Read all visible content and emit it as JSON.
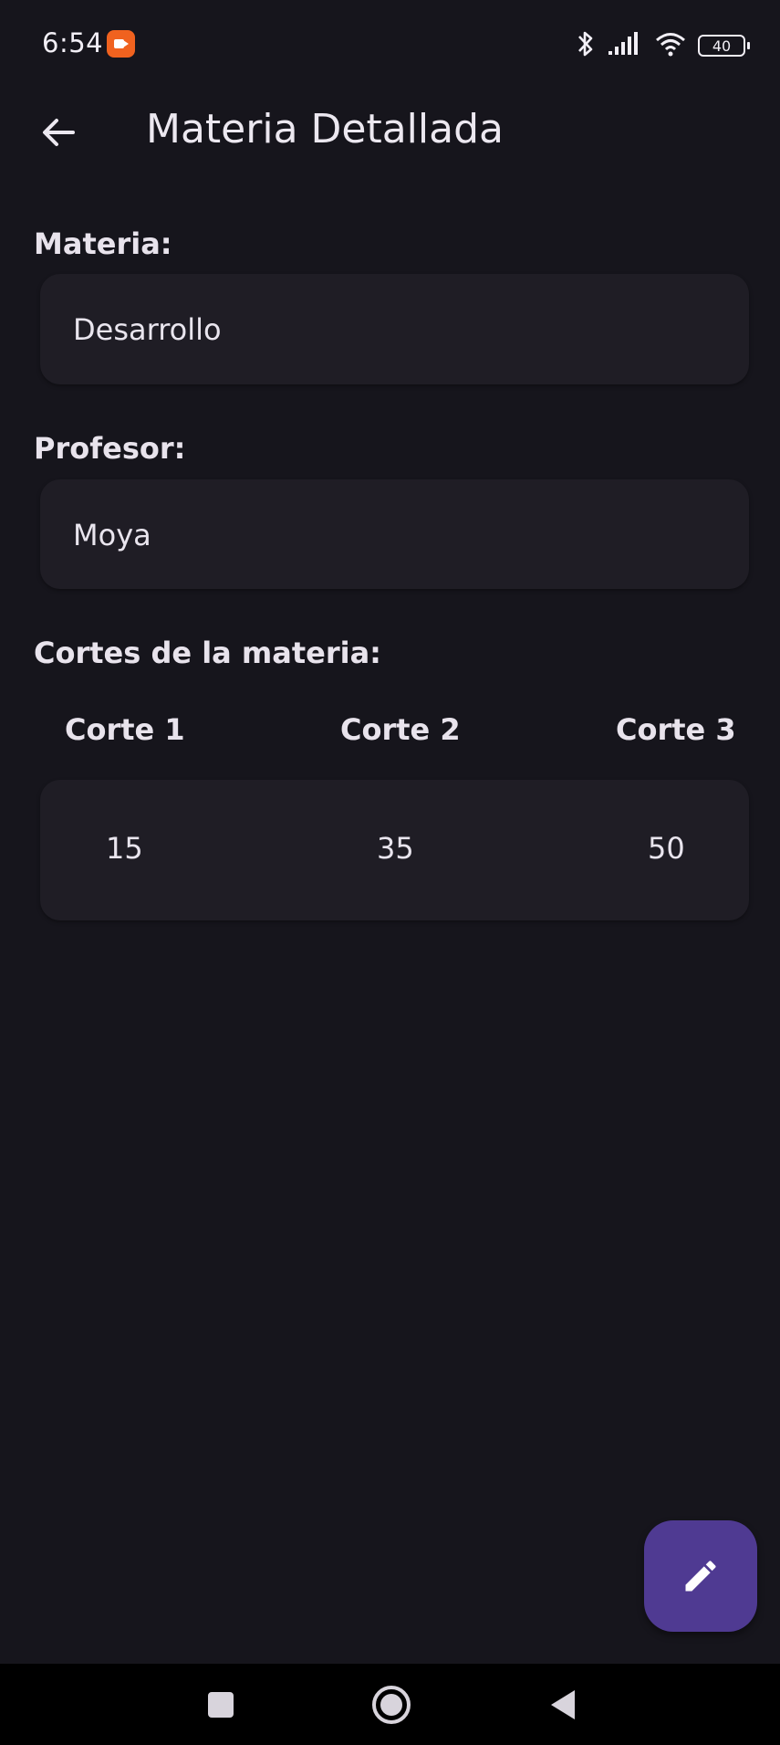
{
  "status_bar": {
    "time": "6:54",
    "battery_level": "40",
    "icons": [
      "screen-record-icon",
      "bluetooth-icon",
      "signal-icon",
      "wifi-icon",
      "battery-icon"
    ]
  },
  "app_bar": {
    "title": "Materia Detallada",
    "back_icon": "arrow-back-icon"
  },
  "materia": {
    "label": "Materia:",
    "value": "Desarrollo"
  },
  "profesor": {
    "label": "Profesor:",
    "value": "Moya"
  },
  "cortes": {
    "label": "Cortes de la materia:",
    "headers": [
      "Corte 1",
      "Corte 2",
      "Corte 3"
    ],
    "values": [
      "15",
      "35",
      "50"
    ]
  },
  "fab": {
    "icon": "edit-pencil-icon",
    "color": "#4f3a92"
  },
  "nav_bar": {
    "buttons": [
      "recents-square-icon",
      "home-circle-icon",
      "back-triangle-icon"
    ]
  },
  "colors": {
    "background": "#16151c",
    "card": "#1f1d25",
    "text": "#e9e5ee",
    "accent_record": "#f0621f"
  }
}
